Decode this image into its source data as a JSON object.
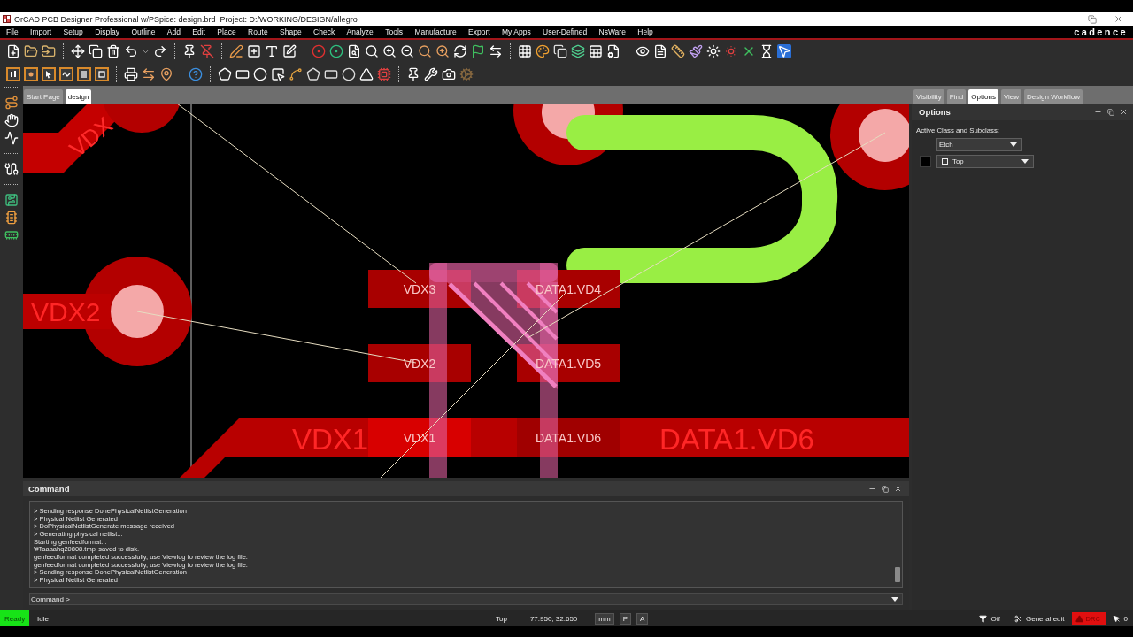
{
  "window": {
    "title": "OrCAD PCB Designer Professional w/PSpice: design.brd  Project: D:/WORKING/DESIGN/allegro"
  },
  "menu": [
    "File",
    "Import",
    "Setup",
    "Display",
    "Outline",
    "Add",
    "Edit",
    "Place",
    "Route",
    "Shape",
    "Check",
    "Analyze",
    "Tools",
    "Manufacture",
    "Export",
    "My Apps",
    "User-Defined",
    "NsWare",
    "Help"
  ],
  "brand": "cadence",
  "document_tabs": [
    {
      "label": "Start Page",
      "selected": false
    },
    {
      "label": "design",
      "selected": true
    }
  ],
  "panel_tabs": [
    {
      "label": "Visibility",
      "selected": false
    },
    {
      "label": "Find",
      "selected": false
    },
    {
      "label": "Options",
      "selected": true
    },
    {
      "label": "View",
      "selected": false
    },
    {
      "label": "Design Workflow",
      "selected": false
    }
  ],
  "canvas": {
    "rotated_label": "VDX",
    "trace_labels": [
      "VDX2",
      "VDX1",
      "DATA1.VD6"
    ],
    "pad_labels": [
      "VDX3",
      "DATA1.VD4",
      "VDX2",
      "DATA1.VD5",
      "VDX1",
      "DATA1.VD6"
    ]
  },
  "options_panel": {
    "title": "Options",
    "class_label": "Active Class and Subclass:",
    "class_value": "Etch",
    "subclass_value": "Top"
  },
  "command_panel": {
    "title": "Command",
    "log": [
      "> Sending response DonePhysicalNetlistGeneration",
      "> Physical Netlist Generated",
      "> DoPhysicalNetlistGenerate message received",
      "> Generating physical netlist...",
      "Starting genfeedformat...",
      "'#Taaaahq20808.tmp' saved to disk.",
      "genfeedformat completed successfully, use Viewlog to review the log file.",
      "genfeedformat completed successfully, use Viewlog to review the log file.",
      "> Sending response DonePhysicalNetlistGeneration",
      "> Physical Netlist Generated"
    ],
    "prompt": "Command >"
  },
  "status_bar": {
    "state": "Ready",
    "activity": "Idle",
    "layer": "Top",
    "coordinates": "77.950, 32.650",
    "units": "mm",
    "toggles": [
      "P",
      "A"
    ],
    "filter": "Off",
    "mode": "General edit",
    "drc": "DRC",
    "selection_count": "0"
  }
}
